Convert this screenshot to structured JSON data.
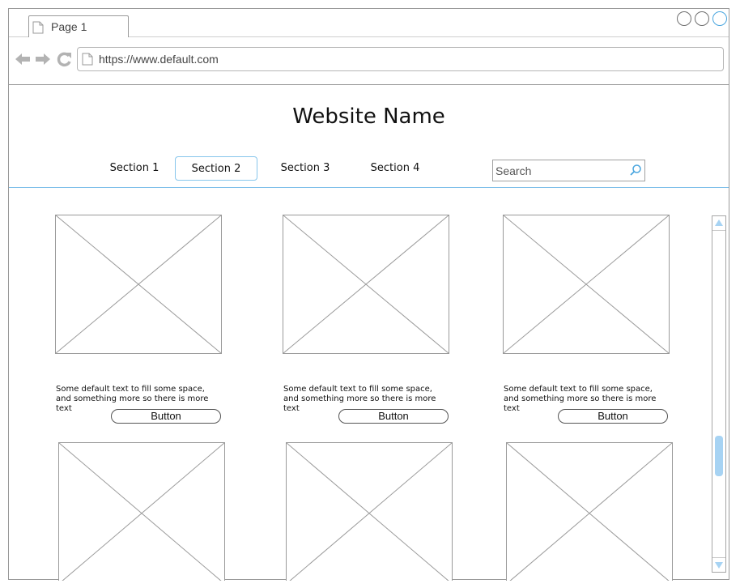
{
  "browser": {
    "tab_label": "Page 1",
    "address": "https://www.default.com"
  },
  "site": {
    "title": "Website Name",
    "nav": [
      {
        "label": "Section 1",
        "active": false
      },
      {
        "label": "Section 2",
        "active": true
      },
      {
        "label": "Section 3",
        "active": false
      },
      {
        "label": "Section 4",
        "active": false
      }
    ],
    "search": {
      "placeholder": "Search"
    }
  },
  "cards": [
    {
      "text": "Some default text to fill some space, and something more so there is more text",
      "button": "Button"
    },
    {
      "text": "Some default text to fill some space, and something more so there is more text",
      "button": "Button"
    },
    {
      "text": "Some default text to fill some space, and something more so there is more text",
      "button": "Button"
    }
  ],
  "scrollbar": {
    "position_fraction": 0.72
  },
  "colors": {
    "accent": "#4aa6df",
    "divider": "#7fc0ea",
    "scroll_thumb": "#a7d3f3",
    "wireframe_stroke": "#9a9a9a"
  },
  "icons": [
    "document-icon",
    "back-arrow-icon",
    "forward-arrow-icon",
    "reload-icon",
    "search-icon",
    "scroll-up-arrow-icon",
    "scroll-down-arrow-icon"
  ]
}
